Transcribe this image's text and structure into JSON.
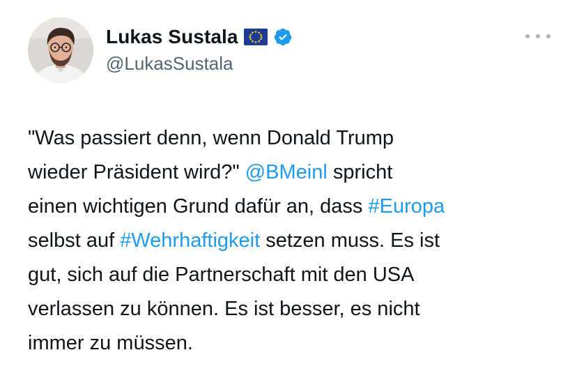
{
  "author": {
    "display_name": "Lukas Sustala",
    "handle": "@LukasSustala",
    "flag_icon": "eu-flag-icon",
    "verified_icon": "verified-badge-icon",
    "verified_color": "#1d9bf0"
  },
  "menu": {
    "icon": "more-options-icon"
  },
  "tweet": {
    "lines": [
      [
        {
          "text": "\"Was passiert denn, wenn Donald Trump",
          "link": false
        }
      ],
      [
        {
          "text": "wieder Präsident wird?\" ",
          "link": false
        },
        {
          "text": "@BMeinl",
          "link": true
        },
        {
          "text": " spricht",
          "link": false
        }
      ],
      [
        {
          "text": "einen wichtigen Grund dafür an, dass ",
          "link": false
        },
        {
          "text": "#Europa",
          "link": true
        }
      ],
      [
        {
          "text": "selbst auf ",
          "link": false
        },
        {
          "text": "#Wehrhaftigkeit",
          "link": true
        },
        {
          "text": " setzen muss. Es ist",
          "link": false
        }
      ],
      [
        {
          "text": "gut, sich auf die Partnerschaft mit den USA",
          "link": false
        }
      ],
      [
        {
          "text": "verlassen zu können. Es ist besser, es nicht",
          "link": false
        }
      ],
      [
        {
          "text": "immer zu müssen.",
          "link": false
        }
      ]
    ]
  },
  "colors": {
    "text": "#0f1419",
    "secondary": "#536471",
    "link": "#1d9bf0",
    "background": "#ffffff"
  }
}
